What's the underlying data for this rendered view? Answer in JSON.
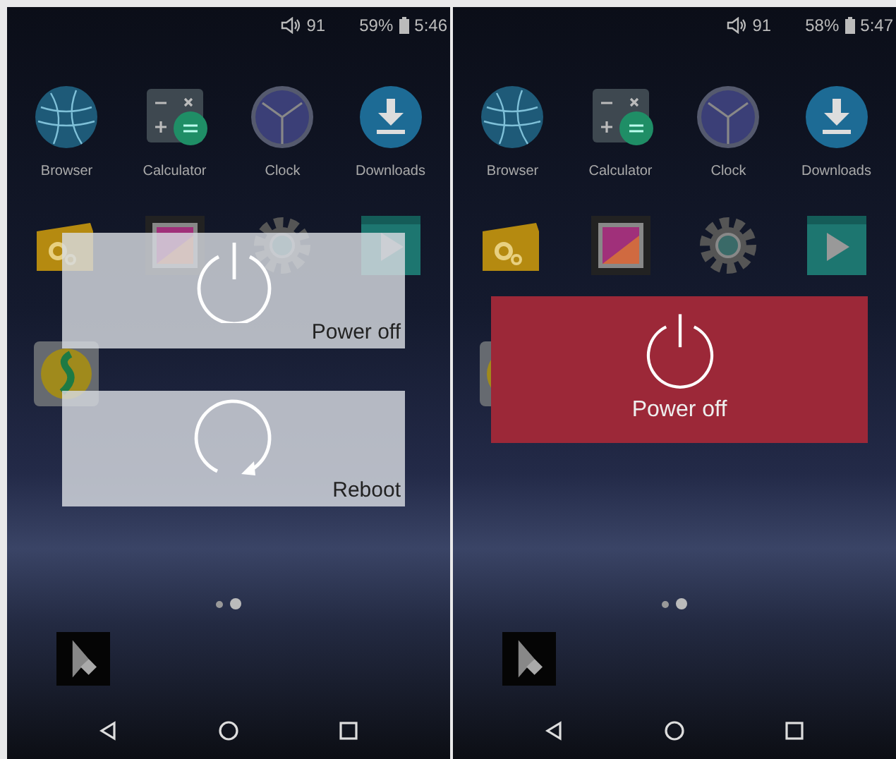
{
  "screens": [
    {
      "status": {
        "volume": "91",
        "battery": "59%",
        "time": "5:46"
      },
      "apps": [
        {
          "label": "Browser",
          "kind": "globe"
        },
        {
          "label": "Calculator",
          "kind": "calculator"
        },
        {
          "label": "Clock",
          "kind": "clock"
        },
        {
          "label": "Downloads",
          "kind": "download"
        },
        {
          "kind": "folder"
        },
        {
          "kind": "gallery"
        },
        {
          "kind": "gear"
        },
        {
          "kind": "video"
        },
        {
          "kind": "music"
        }
      ],
      "pages": [
        {
          "selected": false
        },
        {
          "selected": true
        }
      ],
      "dialog": {
        "kind": "list",
        "options": [
          {
            "label": "Power off",
            "kind": "power"
          },
          {
            "label": "Reboot",
            "kind": "reboot"
          }
        ]
      }
    },
    {
      "status": {
        "volume": "91",
        "battery": "58%",
        "time": "5:47"
      },
      "apps": [
        {
          "label": "Browser",
          "kind": "globe"
        },
        {
          "label": "Calculator",
          "kind": "calculator"
        },
        {
          "label": "Clock",
          "kind": "clock"
        },
        {
          "label": "Downloads",
          "kind": "download"
        },
        {
          "kind": "folder"
        },
        {
          "kind": "gallery"
        },
        {
          "kind": "gear"
        },
        {
          "kind": "video"
        },
        {
          "kind": "music"
        }
      ],
      "pages": [
        {
          "selected": false
        },
        {
          "selected": true
        }
      ],
      "dialog": {
        "kind": "single",
        "options": [
          {
            "label": "Power off",
            "kind": "power"
          }
        ]
      }
    }
  ]
}
